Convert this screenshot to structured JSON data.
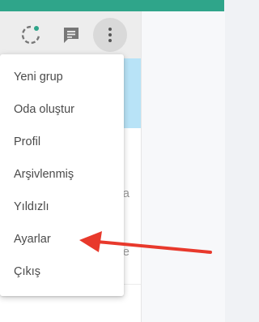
{
  "menu": {
    "items": [
      {
        "label": "Yeni grup"
      },
      {
        "label": "Oda oluştur"
      },
      {
        "label": "Profil"
      },
      {
        "label": "Arşivlenmiş"
      },
      {
        "label": "Yıldızlı"
      },
      {
        "label": "Ayarlar"
      },
      {
        "label": "Çıkış"
      }
    ]
  },
  "background": {
    "row_partial_1": "a",
    "row_partial_2": "e"
  },
  "colors": {
    "accent": "#2fa58a",
    "arrow": "#e8392c",
    "highlight": "#b8e3f7"
  },
  "icons": {
    "status": "status-icon",
    "chat": "chat-icon",
    "menu": "more-vertical-icon"
  }
}
